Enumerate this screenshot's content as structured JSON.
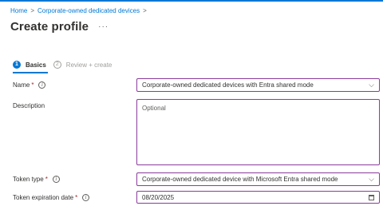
{
  "breadcrumb": {
    "items": [
      "Home",
      "Corporate-owned dedicated devices"
    ],
    "separator": ">"
  },
  "page": {
    "title": "Create profile",
    "more_icon": "ellipsis-icon"
  },
  "tabs": [
    {
      "number": "1",
      "label": "Basics",
      "active": true
    },
    {
      "number": "2",
      "label": "Review + create",
      "active": false
    }
  ],
  "form": {
    "name": {
      "label": "Name",
      "required_mark": "*",
      "value": "Corporate-owned dedicated devices with Entra shared mode"
    },
    "description": {
      "label": "Description",
      "placeholder": "Optional"
    },
    "token_type": {
      "label": "Token type",
      "required_mark": "*",
      "value": "Corporate-owned dedicated device with Microsoft Entra shared mode"
    },
    "token_expiration": {
      "label": "Token expiration date",
      "required_mark": "*",
      "value": "08/20/2025"
    }
  },
  "colors": {
    "accent": "#0078d4",
    "field_border": "#8a3c9b",
    "required": "#a4262c"
  }
}
